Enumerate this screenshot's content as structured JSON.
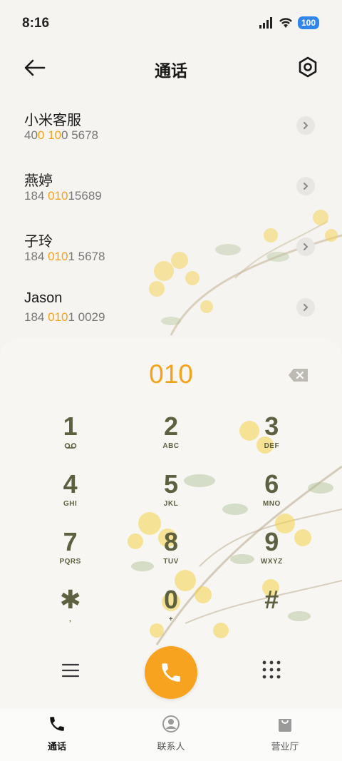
{
  "status_bar": {
    "time": "8:16",
    "battery": "100"
  },
  "header": {
    "title": "通话"
  },
  "contacts": [
    {
      "name": "小米客服",
      "parts": [
        {
          "t": "40",
          "hl": false
        },
        {
          "t": "0 10",
          "hl": true
        },
        {
          "t": "0 5678",
          "hl": false
        }
      ]
    },
    {
      "name": "燕婷",
      "parts": [
        {
          "t": "184 ",
          "hl": false
        },
        {
          "t": "010",
          "hl": true
        },
        {
          "t": "15689",
          "hl": false
        }
      ]
    },
    {
      "name": "子玲",
      "parts": [
        {
          "t": "184 ",
          "hl": false
        },
        {
          "t": "010",
          "hl": true
        },
        {
          "t": "1 5678",
          "hl": false
        }
      ]
    },
    {
      "name": "Jason",
      "parts": [
        {
          "t": "184 ",
          "hl": false
        },
        {
          "t": "010",
          "hl": true
        },
        {
          "t": "1 0029",
          "hl": false
        }
      ]
    }
  ],
  "dialer": {
    "input": "010",
    "keys": [
      {
        "digit": "1",
        "letters": ""
      },
      {
        "digit": "2",
        "letters": "ABC"
      },
      {
        "digit": "3",
        "letters": "DEF"
      },
      {
        "digit": "4",
        "letters": "GHI"
      },
      {
        "digit": "5",
        "letters": "JKL"
      },
      {
        "digit": "6",
        "letters": "MNO"
      },
      {
        "digit": "7",
        "letters": "PQRS"
      },
      {
        "digit": "8",
        "letters": "TUV"
      },
      {
        "digit": "9",
        "letters": "WXYZ"
      },
      {
        "digit": "✱",
        "letters": ","
      },
      {
        "digit": "0",
        "letters": "+"
      },
      {
        "digit": "#",
        "letters": ""
      }
    ]
  },
  "nav": [
    {
      "label": "通话",
      "icon": "phone-icon",
      "active": true
    },
    {
      "label": "联系人",
      "icon": "contact-icon",
      "active": false
    },
    {
      "label": "营业厅",
      "icon": "store-bag-icon",
      "active": false
    }
  ],
  "colors": {
    "accent": "#f5a21b",
    "key_text": "#5e6140",
    "voicemail_blue": "#2f86e8"
  }
}
